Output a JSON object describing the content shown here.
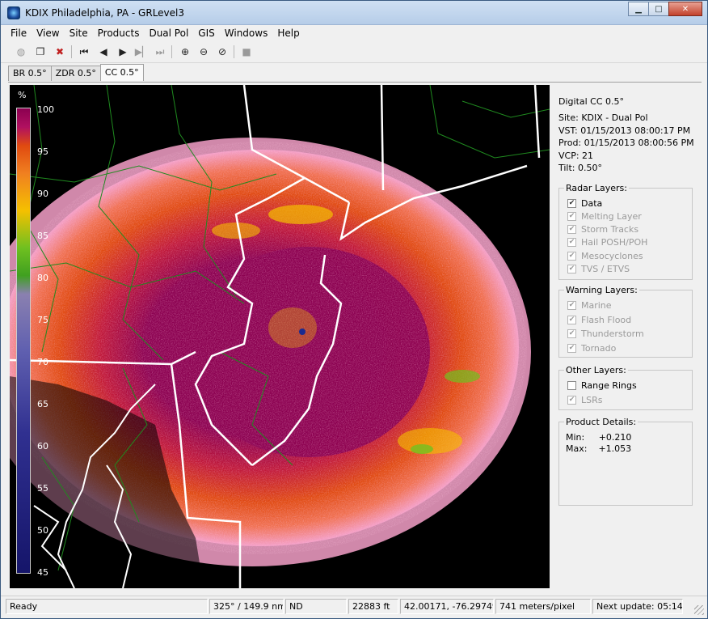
{
  "window": {
    "title": "KDIX Philadelphia, PA - GRLevel3"
  },
  "menu": [
    "File",
    "View",
    "Site",
    "Products",
    "Dual Pol",
    "GIS",
    "Windows",
    "Help"
  ],
  "toolbar": {
    "icons": [
      "globe-icon",
      "copy-icon",
      "delete-icon",
      "skip-first-icon",
      "step-back-icon",
      "play-icon",
      "step-forward-icon",
      "skip-last-icon",
      "zoom-in-icon",
      "zoom-out-icon",
      "zoom-reset-icon",
      "stop-icon"
    ]
  },
  "tabs": [
    "BR 0.5°",
    "ZDR 0.5°",
    "CC 0.5°"
  ],
  "legend": {
    "unit": "%",
    "ticks": [
      "100",
      "95",
      "90",
      "85",
      "80",
      "75",
      "70",
      "65",
      "60",
      "55",
      "50",
      "45"
    ]
  },
  "info": {
    "product": "Digital CC 0.5°",
    "site_label": "Site:",
    "site": "KDIX - Dual Pol",
    "vst_label": "VST:",
    "vst": "01/15/2013  08:00:17 PM",
    "prod_label": "Prod:",
    "prod": "01/15/2013  08:00:56 PM",
    "vcp_label": "VCP:",
    "vcp": "21",
    "tilt_label": "Tilt:",
    "tilt": "0.50°"
  },
  "radar_layers": {
    "title": "Radar Layers:",
    "items": [
      "Data",
      "Melting Layer",
      "Storm Tracks",
      "Hail POSH/POH",
      "Mesocyclones",
      "TVS / ETVS"
    ]
  },
  "warning_layers": {
    "title": "Warning Layers:",
    "items": [
      "Marine",
      "Flash Flood",
      "Thunderstorm",
      "Tornado"
    ]
  },
  "other_layers": {
    "title": "Other Layers:",
    "items": [
      "Range Rings",
      "LSRs"
    ]
  },
  "product_details": {
    "title": "Product Details:",
    "min_label": "Min:",
    "min": "+0.210",
    "max_label": "Max:",
    "max": "+1.053"
  },
  "status": {
    "state": "Ready",
    "bearing": "325° / 149.9 nm",
    "value": "ND",
    "height": "22883 ft",
    "coords": "42.00171, -76.29749",
    "scale": "741 meters/pixel",
    "next_update": "Next update: 05:14"
  },
  "colors": {
    "cc_high": "#8b0050",
    "cc_orange": "#e04a10",
    "cc_pink": "#f4a0c8",
    "cc_yellow": "#f5c000",
    "cc_green": "#70c020",
    "borders": "#ffffff",
    "counties": "#1f8a1f"
  }
}
